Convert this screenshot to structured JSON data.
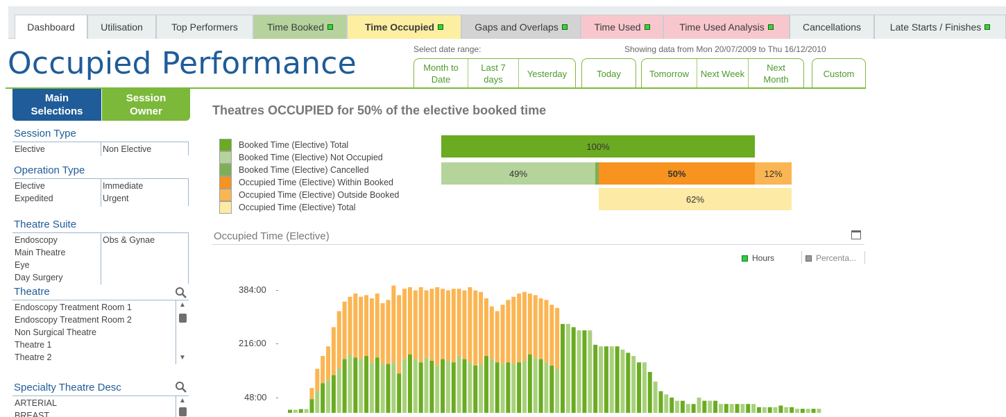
{
  "tabs": [
    {
      "label": "Dashboard",
      "status": false
    },
    {
      "label": "Utilisation",
      "status": false
    },
    {
      "label": "Top Performers",
      "status": false
    },
    {
      "label": "Time Booked",
      "status": true
    },
    {
      "label": "Time Occupied",
      "status": true
    },
    {
      "label": "Gaps and Overlaps",
      "status": true
    },
    {
      "label": "Time Used",
      "status": true
    },
    {
      "label": "Time Used Analysis",
      "status": true
    },
    {
      "label": "Cancellations",
      "status": false
    },
    {
      "label": "Late Starts / Finishes",
      "status": true
    }
  ],
  "header": {
    "title": "Occupied Performance",
    "date_range_label": "Select date range:",
    "showing_text": "Showing data from Mon 20/07/2009 to Thu 16/12/2010",
    "date_buttons": {
      "month_to_date_1": "Month to",
      "month_to_date_2": "Date",
      "last7_1": "Last 7",
      "last7_2": "days",
      "yesterday": "Yesterday",
      "today": "Today",
      "tomorrow": "Tomorrow",
      "next_week": "Next Week",
      "next_month_1": "Next",
      "next_month_2": "Month",
      "custom": "Custom"
    }
  },
  "sidebar": {
    "tab_main_1": "Main",
    "tab_main_2": "Selections",
    "tab_owner_1": "Session",
    "tab_owner_2": "Owner",
    "session_type": {
      "title": "Session Type",
      "col1": [
        "Elective"
      ],
      "col2": [
        "Non Elective"
      ]
    },
    "operation_type": {
      "title": "Operation Type",
      "col1": [
        "Elective",
        "Expedited"
      ],
      "col2": [
        "Immediate",
        "Urgent"
      ]
    },
    "theatre_suite": {
      "title": "Theatre Suite",
      "col1": [
        "Endoscopy",
        "Main Theatre",
        "Eye",
        "Day Surgery"
      ],
      "col2": [
        "Obs & Gynae"
      ]
    },
    "theatre": {
      "title": "Theatre",
      "items": [
        "Endoscopy Treatment Room 1",
        "Endoscopy Treatment Room 2",
        "Non Surgical Theatre",
        "Theatre 1",
        "Theatre 2"
      ]
    },
    "specialty": {
      "title": "Specialty Theatre Desc",
      "items": [
        "ARTERIAL",
        "BREAST"
      ]
    }
  },
  "main": {
    "headline": "Theatres OCCUPIED for 50% of the elective booked time",
    "legend": [
      {
        "label": "Booked Time (Elective) Total",
        "color": "#6aab22"
      },
      {
        "label": "Booked Time (Elective) Not Occupied",
        "color": "#b5d49b"
      },
      {
        "label": "Booked Time (Elective) Cancelled",
        "color": "#7faf55"
      },
      {
        "label": "Occupied Time (Elective) Within Booked",
        "color": "#f7931e"
      },
      {
        "label": "Occupied Time (Elective) Outside Booked",
        "color": "#fbb552"
      },
      {
        "label": "Occupied Time (Elective) Total",
        "color": "#fdeaa5"
      }
    ],
    "summary_bars": {
      "booked_total": 100,
      "not_occupied": 49,
      "cancelled": 1,
      "within_booked": 50,
      "outside_booked": 12,
      "occupied_total": 62,
      "labels": {
        "total": "100%",
        "not_occupied": "49%",
        "within": "50%",
        "outside": "12%",
        "occupied": "62%"
      }
    },
    "chart_panel_title": "Occupied Time (Elective)",
    "series_legend": {
      "hours": "Hours",
      "percent": "Percenta..."
    }
  },
  "colors": {
    "accent_blue": "#1f5c99",
    "accent_green": "#7cb83a",
    "bar_dark_green": "#6aab22",
    "bar_light_green": "#a9d17c",
    "bar_orange_light": "#fbb552"
  },
  "chart_data": {
    "type": "bar",
    "ylabel": "",
    "yticks": [
      "384:00",
      "216:00",
      "48:00"
    ],
    "ytick_values": [
      384,
      216,
      48
    ],
    "ylim": [
      0,
      400
    ],
    "series": [
      {
        "name": "Hours",
        "values": [
          2,
          2,
          4,
          4,
          35,
          60,
          85,
          95,
          110,
          130,
          160,
          175,
          165,
          160,
          170,
          150,
          165,
          145,
          145,
          150,
          115,
          160,
          175,
          160,
          150,
          165,
          155,
          140,
          160,
          155,
          150,
          170,
          160,
          150,
          140,
          145,
          170,
          160,
          150,
          145,
          150,
          145,
          150,
          155,
          175,
          165,
          160,
          150,
          140,
          130,
          270,
          270,
          260,
          250,
          250,
          250,
          205,
          200,
          200,
          200,
          200,
          190,
          180,
          170,
          150,
          150,
          120,
          90,
          60,
          50,
          40,
          30,
          30,
          20,
          20,
          40,
          30,
          30,
          30,
          20,
          20,
          20,
          20,
          20,
          20,
          20,
          10,
          10,
          10,
          10,
          15,
          10,
          10,
          5,
          5,
          5,
          5,
          5
        ]
      },
      {
        "name": "Occupied",
        "values": [
          0,
          0,
          0,
          0,
          70,
          130,
          170,
          200,
          260,
          310,
          340,
          355,
          365,
          355,
          360,
          350,
          365,
          335,
          345,
          390,
          360,
          380,
          385,
          375,
          385,
          375,
          380,
          385,
          380,
          375,
          380,
          380,
          375,
          385,
          375,
          370,
          350,
          325,
          310,
          330,
          345,
          355,
          365,
          370,
          365,
          360,
          350,
          345,
          330,
          320,
          270,
          270,
          260,
          250,
          250,
          250,
          205,
          200,
          200,
          200,
          200,
          190,
          180,
          170,
          150,
          150,
          120,
          90,
          60,
          50,
          40,
          30,
          30,
          20,
          20,
          40,
          30,
          30,
          30,
          20,
          20,
          20,
          20,
          20,
          20,
          20,
          10,
          10,
          10,
          10,
          15,
          10,
          10,
          5,
          5,
          5,
          5,
          5
        ]
      }
    ]
  }
}
